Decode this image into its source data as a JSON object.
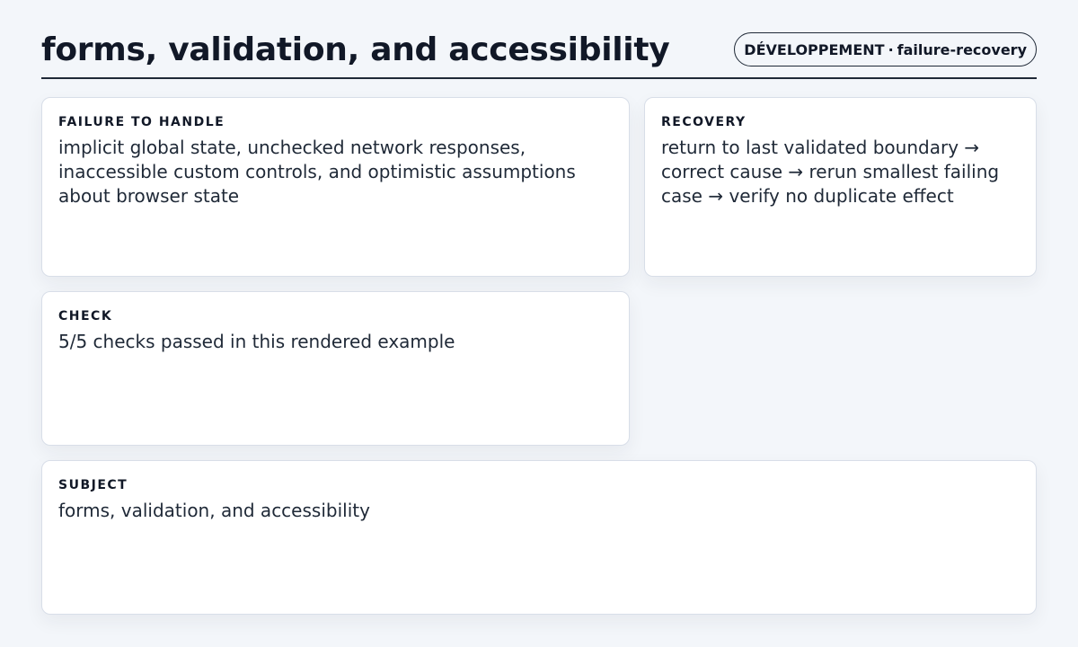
{
  "header": {
    "title": "forms, validation, and accessibility",
    "badge_category": "DÉVELOPPEMENT",
    "badge_separator": "·",
    "badge_tag": "failure-recovery"
  },
  "cards": {
    "failure": {
      "label": "FAILURE TO HANDLE",
      "text": "implicit global state, unchecked network responses, inaccessible custom controls, and optimistic assumptions about browser state"
    },
    "recovery": {
      "label": "RECOVERY",
      "text": "return to last validated boundary → correct cause → rerun smallest failing case → verify no duplicate effect"
    },
    "check": {
      "label": "CHECK",
      "text": "5/5 checks passed in this rendered example"
    },
    "subject": {
      "label": "SUBJECT",
      "text": "forms, validation, and accessibility"
    }
  }
}
